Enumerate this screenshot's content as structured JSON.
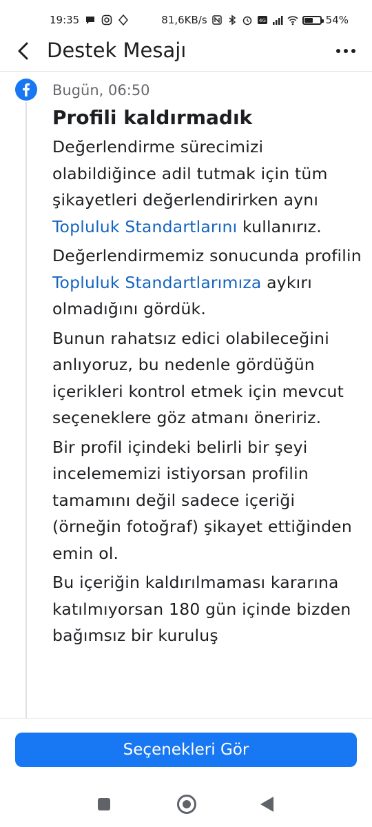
{
  "status_bar": {
    "time": "19:35",
    "network_speed": "81,6KB/s",
    "battery_percent": "54%",
    "battery_level": 0.54,
    "icons": [
      "chat-notification-icon",
      "instagram-icon",
      "navigation-icon",
      "nfc-icon",
      "bluetooth-icon",
      "alarm-icon",
      "volte-icon",
      "signal-icon",
      "wifi-icon",
      "battery-icon"
    ]
  },
  "header": {
    "title": "Destek Mesajı",
    "back_icon": "chevron-left-icon",
    "more_icon": "more-horizontal-icon"
  },
  "message": {
    "sender_icon": "facebook-icon",
    "timestamp": "Bugün, 06:50",
    "title": "Profili kaldırmadık",
    "p1_before": "Değerlendirme sürecimizi olabildiğince adil tutmak için tüm şikayetleri değerlendirirken aynı ",
    "p1_link": "Topluluk Standartlarını",
    "p1_after": " kullanırız.",
    "p2_before": "Değerlendirmemiz sonucunda profilin ",
    "p2_link": "Topluluk Standartlarımıza",
    "p2_after": " aykırı olmadığını gördük.",
    "p3": "Bunun rahatsız edici olabileceğini anlıyoruz, bu nedenle gördüğün içerikleri kontrol etmek için mevcut seçeneklere göz atmanı öneririz.",
    "p4": "Bir profil içindeki belirli bir şeyi incelememizi istiyorsan profilin tamamını değil sadece içeriği (örneğin fotoğraf) şikayet ettiğinden emin ol.",
    "p5": "Bu içeriğin kaldırılmaması kararına katılmıyorsan 180 gün içinde bizden bağımsız bir kuruluş"
  },
  "cta": {
    "label": "Seçenekleri Gör"
  },
  "colors": {
    "accent": "#1877f2",
    "link": "#1565c0",
    "text": "#1c1e21",
    "muted": "#65676b"
  },
  "nav_bar": {
    "icons": [
      "recent-apps-icon",
      "home-icon",
      "back-icon"
    ]
  }
}
